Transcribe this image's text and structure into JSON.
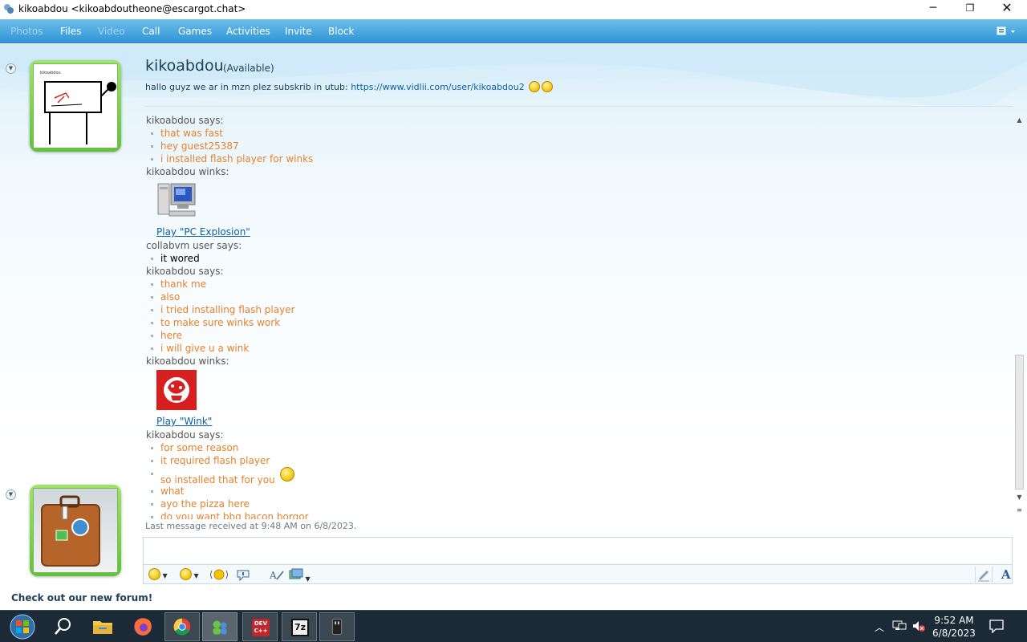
{
  "window": {
    "title": "kikoabdou <kikoabdoutheone@escargot.chat>",
    "controls": {
      "minimize": "─",
      "maximize": "❐",
      "close": "✕"
    }
  },
  "menu": {
    "items": [
      {
        "label": "Photos",
        "enabled": false
      },
      {
        "label": "Files",
        "enabled": true
      },
      {
        "label": "Video",
        "enabled": false
      },
      {
        "label": "Call",
        "enabled": true
      },
      {
        "label": "Games",
        "enabled": true
      },
      {
        "label": "Activities",
        "enabled": true
      },
      {
        "label": "Invite",
        "enabled": true
      },
      {
        "label": "Block",
        "enabled": true
      }
    ]
  },
  "contact": {
    "name": "kikoabdou",
    "status": "(Available)",
    "personal_message": "hallo guyz we ar in mzn plez subskrib in utub: ",
    "link": "https://www.vidlii.com/user/kikoabdou2",
    "avatar_caption": "kikoabdou"
  },
  "conversation": {
    "entries": [
      {
        "kind": "sender",
        "text": "kikoabdou says:"
      },
      {
        "kind": "msg",
        "text": "that was fast"
      },
      {
        "kind": "msg",
        "text": "hey guest25387"
      },
      {
        "kind": "msg",
        "text": "i installed flash player for winks"
      },
      {
        "kind": "sender",
        "text": "kikoabdou winks:"
      },
      {
        "kind": "wink",
        "icon": "computer-wink-icon",
        "link": "Play \"PC Explosion\""
      },
      {
        "kind": "sender",
        "text": "collabvm user says:"
      },
      {
        "kind": "msg-black",
        "text": "it wored"
      },
      {
        "kind": "sender",
        "text": "kikoabdou says:"
      },
      {
        "kind": "msg",
        "text": "thank me"
      },
      {
        "kind": "msg",
        "text": "also"
      },
      {
        "kind": "msg",
        "text": "i tried installing flash player"
      },
      {
        "kind": "msg",
        "text": "to make sure winks work"
      },
      {
        "kind": "msg",
        "text": "here"
      },
      {
        "kind": "msg",
        "text": "i will give u a wink"
      },
      {
        "kind": "sender",
        "text": "kikoabdou winks:"
      },
      {
        "kind": "wink",
        "icon": "red-wink-icon",
        "link": "Play \"Wink\""
      },
      {
        "kind": "sender",
        "text": "kikoabdou says:"
      },
      {
        "kind": "msg",
        "text": "for some reason"
      },
      {
        "kind": "msg",
        "text": "it required flash player"
      },
      {
        "kind": "msg-emo",
        "text": "so installed that for you"
      },
      {
        "kind": "msg",
        "text": "what"
      },
      {
        "kind": "msg",
        "text": "ayo the pizza here"
      },
      {
        "kind": "msg",
        "text": "do you want bbq bacon borgor"
      }
    ],
    "last_received": "Last message received at 9:48 AM on 6/8/2023."
  },
  "input": {
    "value": ""
  },
  "toolbar_icons": [
    "emoticon-icon",
    "wink-icon",
    "nudge-icon",
    "voice-clip-icon",
    "handwriting-icon",
    "background-icon",
    "font-icon"
  ],
  "footer": {
    "link": "Check out our new forum!"
  },
  "taskbar": {
    "apps": [
      "start-icon",
      "search-icon",
      "file-explorer-icon",
      "firefox-icon",
      "chrome-icon",
      "messenger-icon",
      "devcpp-icon",
      "7zip-icon",
      "usb-icon"
    ],
    "devcpp_label": "DEV C++",
    "sevenzip_label": "7z",
    "time": "9:52 AM",
    "date": "6/8/2023"
  },
  "colors": {
    "menu_bar": "#2f94d6",
    "message_text": "#e8802b",
    "link": "#0b5fa5",
    "avatar_frame": "#5fc23a"
  }
}
